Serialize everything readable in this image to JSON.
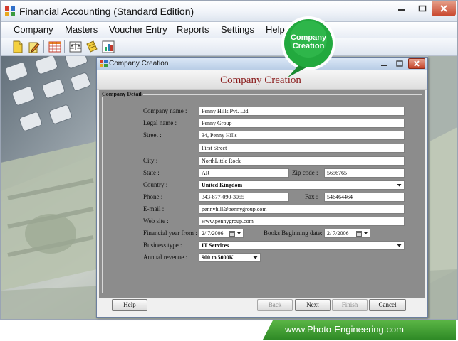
{
  "app": {
    "title": "Financial Accounting (Standard Edition)",
    "icon": "app-logo-icon"
  },
  "menu": {
    "items": [
      "Company",
      "Masters",
      "Voucher Entry",
      "Reports",
      "Settings",
      "Help"
    ]
  },
  "toolbar": {
    "icons": [
      "new-company-icon",
      "open-company-icon",
      "spreadsheet-icon",
      "balance-scale-icon",
      "edit-voucher-icon",
      "report-chart-icon"
    ]
  },
  "callout": {
    "text": "Company Creation",
    "color": "#1fa83c"
  },
  "dialog": {
    "title": "Company Creation",
    "heading": "Company Creation",
    "group_label": "Company Detail",
    "labels": {
      "company_name": "Company name :",
      "legal_name": "Legal name :",
      "street": "Street :",
      "city": "City :",
      "state": "State :",
      "zip": "Zip code :",
      "country": "Country :",
      "phone": "Phone :",
      "fax": "Fax :",
      "email": "E-mail :",
      "website": "Web site :",
      "fy_from": "Financial year from :",
      "books_begin": "Books Beginning date:",
      "business_type": "Business type :",
      "annual_revenue": "Annual revenue :"
    },
    "values": {
      "company_name": "Penny Hills Pvt. Ltd.",
      "legal_name": "Penny Group",
      "street1": "34, Penny Hills",
      "street2": "First Street",
      "city": "NorthLittle Rock",
      "state": "AR",
      "zip": "5656765",
      "country": "United Kingdom",
      "phone": "343-877-090-3055",
      "fax": "546464464",
      "email": "pennyhill@pennygroup.com",
      "website": "www.pennygroup.com",
      "fy_from": "2/ 7/2006",
      "books_begin": "2/ 7/2006",
      "business_type": "IT Services",
      "annual_revenue": "900 to 5000K"
    },
    "buttons": {
      "help": "Help",
      "back": "Back",
      "next": "Next",
      "finish": "Finish",
      "cancel": "Cancel"
    }
  },
  "banner": {
    "text": "www.Photo-Engineering.com",
    "color": "#3a9a2e"
  }
}
